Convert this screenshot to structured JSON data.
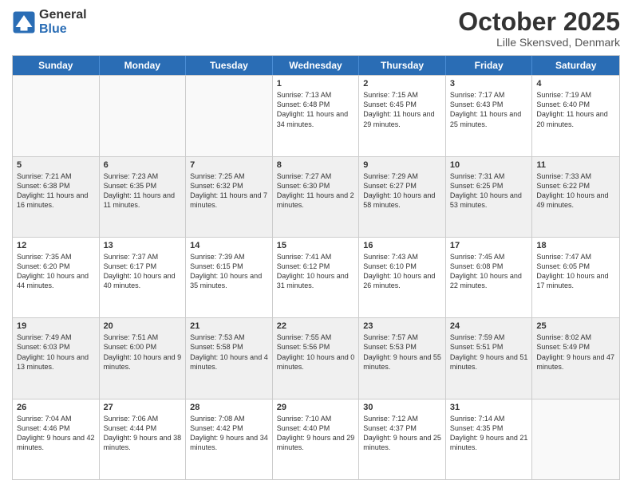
{
  "logo": {
    "general": "General",
    "blue": "Blue"
  },
  "header": {
    "month": "October 2025",
    "location": "Lille Skensved, Denmark"
  },
  "days": [
    "Sunday",
    "Monday",
    "Tuesday",
    "Wednesday",
    "Thursday",
    "Friday",
    "Saturday"
  ],
  "rows": [
    [
      {
        "day": "",
        "empty": true
      },
      {
        "day": "",
        "empty": true
      },
      {
        "day": "",
        "empty": true
      },
      {
        "day": "1",
        "sunrise": "7:13 AM",
        "sunset": "6:48 PM",
        "daylight": "11 hours and 34 minutes."
      },
      {
        "day": "2",
        "sunrise": "7:15 AM",
        "sunset": "6:45 PM",
        "daylight": "11 hours and 29 minutes."
      },
      {
        "day": "3",
        "sunrise": "7:17 AM",
        "sunset": "6:43 PM",
        "daylight": "11 hours and 25 minutes."
      },
      {
        "day": "4",
        "sunrise": "7:19 AM",
        "sunset": "6:40 PM",
        "daylight": "11 hours and 20 minutes."
      }
    ],
    [
      {
        "day": "5",
        "sunrise": "7:21 AM",
        "sunset": "6:38 PM",
        "daylight": "11 hours and 16 minutes."
      },
      {
        "day": "6",
        "sunrise": "7:23 AM",
        "sunset": "6:35 PM",
        "daylight": "11 hours and 11 minutes."
      },
      {
        "day": "7",
        "sunrise": "7:25 AM",
        "sunset": "6:32 PM",
        "daylight": "11 hours and 7 minutes."
      },
      {
        "day": "8",
        "sunrise": "7:27 AM",
        "sunset": "6:30 PM",
        "daylight": "11 hours and 2 minutes."
      },
      {
        "day": "9",
        "sunrise": "7:29 AM",
        "sunset": "6:27 PM",
        "daylight": "10 hours and 58 minutes."
      },
      {
        "day": "10",
        "sunrise": "7:31 AM",
        "sunset": "6:25 PM",
        "daylight": "10 hours and 53 minutes."
      },
      {
        "day": "11",
        "sunrise": "7:33 AM",
        "sunset": "6:22 PM",
        "daylight": "10 hours and 49 minutes."
      }
    ],
    [
      {
        "day": "12",
        "sunrise": "7:35 AM",
        "sunset": "6:20 PM",
        "daylight": "10 hours and 44 minutes."
      },
      {
        "day": "13",
        "sunrise": "7:37 AM",
        "sunset": "6:17 PM",
        "daylight": "10 hours and 40 minutes."
      },
      {
        "day": "14",
        "sunrise": "7:39 AM",
        "sunset": "6:15 PM",
        "daylight": "10 hours and 35 minutes."
      },
      {
        "day": "15",
        "sunrise": "7:41 AM",
        "sunset": "6:12 PM",
        "daylight": "10 hours and 31 minutes."
      },
      {
        "day": "16",
        "sunrise": "7:43 AM",
        "sunset": "6:10 PM",
        "daylight": "10 hours and 26 minutes."
      },
      {
        "day": "17",
        "sunrise": "7:45 AM",
        "sunset": "6:08 PM",
        "daylight": "10 hours and 22 minutes."
      },
      {
        "day": "18",
        "sunrise": "7:47 AM",
        "sunset": "6:05 PM",
        "daylight": "10 hours and 17 minutes."
      }
    ],
    [
      {
        "day": "19",
        "sunrise": "7:49 AM",
        "sunset": "6:03 PM",
        "daylight": "10 hours and 13 minutes."
      },
      {
        "day": "20",
        "sunrise": "7:51 AM",
        "sunset": "6:00 PM",
        "daylight": "10 hours and 9 minutes."
      },
      {
        "day": "21",
        "sunrise": "7:53 AM",
        "sunset": "5:58 PM",
        "daylight": "10 hours and 4 minutes."
      },
      {
        "day": "22",
        "sunrise": "7:55 AM",
        "sunset": "5:56 PM",
        "daylight": "10 hours and 0 minutes."
      },
      {
        "day": "23",
        "sunrise": "7:57 AM",
        "sunset": "5:53 PM",
        "daylight": "9 hours and 55 minutes."
      },
      {
        "day": "24",
        "sunrise": "7:59 AM",
        "sunset": "5:51 PM",
        "daylight": "9 hours and 51 minutes."
      },
      {
        "day": "25",
        "sunrise": "8:02 AM",
        "sunset": "5:49 PM",
        "daylight": "9 hours and 47 minutes."
      }
    ],
    [
      {
        "day": "26",
        "sunrise": "7:04 AM",
        "sunset": "4:46 PM",
        "daylight": "9 hours and 42 minutes."
      },
      {
        "day": "27",
        "sunrise": "7:06 AM",
        "sunset": "4:44 PM",
        "daylight": "9 hours and 38 minutes."
      },
      {
        "day": "28",
        "sunrise": "7:08 AM",
        "sunset": "4:42 PM",
        "daylight": "9 hours and 34 minutes."
      },
      {
        "day": "29",
        "sunrise": "7:10 AM",
        "sunset": "4:40 PM",
        "daylight": "9 hours and 29 minutes."
      },
      {
        "day": "30",
        "sunrise": "7:12 AM",
        "sunset": "4:37 PM",
        "daylight": "9 hours and 25 minutes."
      },
      {
        "day": "31",
        "sunrise": "7:14 AM",
        "sunset": "4:35 PM",
        "daylight": "9 hours and 21 minutes."
      },
      {
        "day": "",
        "empty": true
      }
    ]
  ],
  "labels": {
    "sunrise": "Sunrise:",
    "sunset": "Sunset:",
    "daylight": "Daylight:"
  }
}
